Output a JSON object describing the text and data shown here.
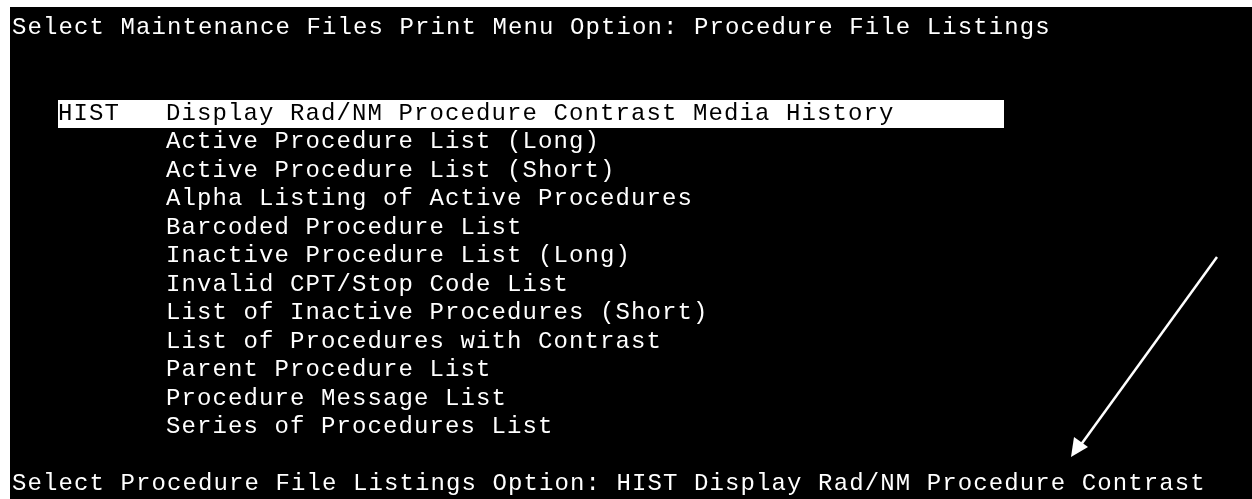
{
  "terminal": {
    "prompt_line": {
      "prompt": "Select Maintenance Files Print Menu Option:",
      "value": "Procedure File Listings"
    },
    "menu_items": [
      {
        "code": "HIST",
        "label": "Display Rad/NM Procedure Contrast Media History",
        "selected": true
      },
      {
        "label": "Active Procedure List (Long)",
        "selected": false
      },
      {
        "label": "Active Procedure List (Short)",
        "selected": false
      },
      {
        "label": "Alpha Listing of Active Procedures",
        "selected": false
      },
      {
        "label": "Barcoded Procedure List",
        "selected": false
      },
      {
        "label": "Inactive Procedure List (Long)",
        "selected": false
      },
      {
        "label": "Invalid CPT/Stop Code List",
        "selected": false
      },
      {
        "label": "List of Inactive Procedures (Short)",
        "selected": false
      },
      {
        "label": "List of Procedures with Contrast",
        "selected": false
      },
      {
        "label": "Parent Procedure List",
        "selected": false
      },
      {
        "label": "Procedure Message List",
        "selected": false
      },
      {
        "label": "Series of Procedures List",
        "selected": false
      }
    ],
    "input_line": {
      "prompt": "Select Procedure File Listings Option:",
      "value": "HIST Display Rad/NM Procedure Contrast"
    }
  }
}
